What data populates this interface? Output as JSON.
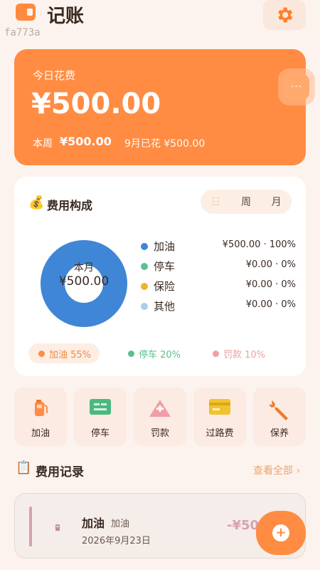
{
  "header": {
    "title": "记账",
    "app_icon": "wallet-icon",
    "settings_icon": "gear-icon",
    "debug_code": "fa773a"
  },
  "today": {
    "label": "今日花费",
    "amount": "¥500.00",
    "week_label": "本周",
    "week_value": "¥500.00",
    "month_text": "9月已花 ¥500.00",
    "more_label": "···"
  },
  "composition": {
    "icon": "💰",
    "title": "费用构成",
    "tabs": [
      "日",
      "周",
      "月"
    ],
    "center_label": "本月",
    "center_value": "¥500.00",
    "legend": [
      {
        "name": "加油",
        "value": "¥500.00 · 100%",
        "color": "#3f86d6"
      },
      {
        "name": "停车",
        "value": "¥0.00 · 0%",
        "color": "#5cc08e"
      },
      {
        "name": "保险",
        "value": "¥0.00 · 0%",
        "color": "#f0b429"
      },
      {
        "name": "其他",
        "value": "¥0.00 · 0%",
        "color": "#a9cdea"
      }
    ],
    "pills": [
      {
        "label": "加油 55%",
        "color": "#ff8c42"
      },
      {
        "label": "停车 20%",
        "color": "#5cbf8a"
      },
      {
        "label": "罚款 10%",
        "color": "#eea0a0"
      }
    ]
  },
  "categories": [
    {
      "label": "加油",
      "icon": "fuel-pump-icon"
    },
    {
      "label": "停车",
      "icon": "parking-icon"
    },
    {
      "label": "罚款",
      "icon": "warning-icon"
    },
    {
      "label": "过路费",
      "icon": "toll-card-icon"
    },
    {
      "label": "保养",
      "icon": "wrench-icon"
    }
  ],
  "records": {
    "icon": "📋",
    "title": "费用记录",
    "view_all": "查看全部 ›",
    "items": [
      {
        "name": "加油",
        "tag": "加油",
        "date": "2026年9月23日",
        "amount": "-¥500"
      }
    ]
  },
  "fab": {
    "label": "+",
    "icon": "add-icon"
  }
}
